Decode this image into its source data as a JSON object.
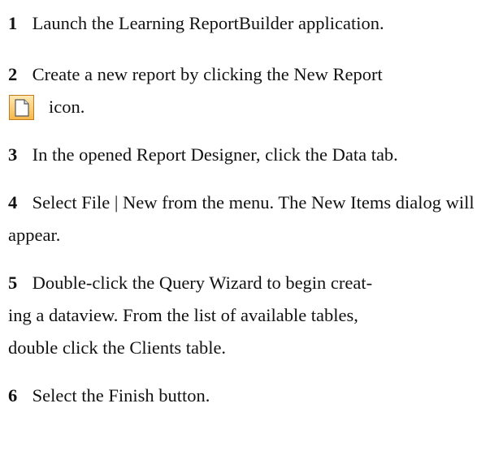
{
  "steps": [
    {
      "number": "1",
      "text": "Launch the Learning ReportBuilder application."
    },
    {
      "number": "2",
      "text": "Create a new report by clicking the New Report",
      "continuation": "icon.",
      "icon": "new-report-icon"
    },
    {
      "number": "3",
      "text": "In the opened Report Designer, click the Data tab."
    },
    {
      "number": "4",
      "text": "Select File | New from the menu.  The New Items dialog will appear."
    },
    {
      "number": "5",
      "text": "Double-click the Query Wizard to begin creating a dataview.  From the list of available tables, double click the Clients table.",
      "line1": "Double-click the Query Wizard to begin creat-",
      "line2": "ing a dataview.  From the list of available tables,",
      "line3": "double click the Clients table."
    },
    {
      "number": "6",
      "text": "Select the Finish button."
    }
  ],
  "colors": {
    "icon_border": "#c47a1a",
    "icon_fill": "#f5b84a"
  }
}
